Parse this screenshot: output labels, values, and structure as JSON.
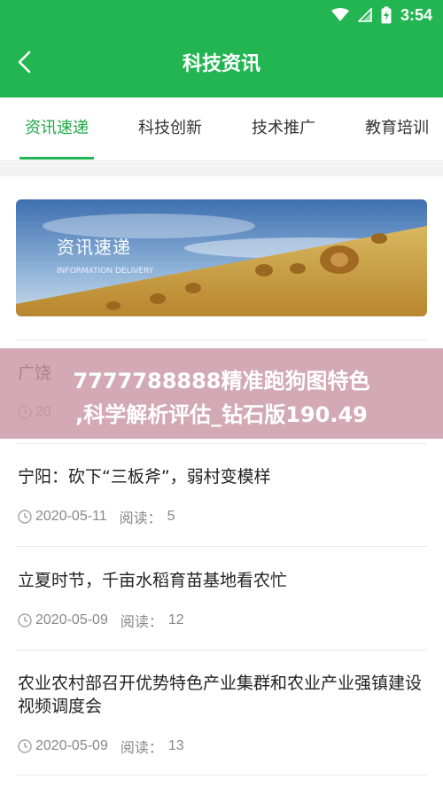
{
  "status_bar": {
    "time": "3:54",
    "icons": [
      "wifi-icon",
      "signal-icon",
      "battery-icon"
    ]
  },
  "header": {
    "title": "科技资讯",
    "back_icon": "chevron-left-icon",
    "color": "#22b551"
  },
  "tabs": [
    {
      "label": "资讯速递",
      "active": true
    },
    {
      "label": "科技创新",
      "active": false
    },
    {
      "label": "技术推广",
      "active": false
    },
    {
      "label": "教育培训",
      "active": false
    }
  ],
  "banner": {
    "title": "资讯速递",
    "subtitle": "INFORMATION DELIVERY"
  },
  "articles": [
    {
      "title": "广饶",
      "date": "20",
      "read_label": "",
      "reads": ""
    },
    {
      "title": "宁阳：砍下“三板斧”，弱村变模样",
      "date": "2020-05-11",
      "read_label": "阅读：",
      "reads": "5"
    },
    {
      "title": "立夏时节，千亩水稻育苗基地看农忙",
      "date": "2020-05-09",
      "read_label": "阅读：",
      "reads": "12"
    },
    {
      "title": "农业农村部召开优势特色产业集群和农业产业强镇建设视频调度会",
      "date": "2020-05-09",
      "read_label": "阅读：",
      "reads": "13"
    }
  ],
  "overlay": {
    "line1": "7777788888精准跑狗图特色",
    "line2": ",科学解析评估_钻石版190.49"
  },
  "colors": {
    "accent": "#22b551",
    "active_tab_text": "#22a84a",
    "overlay": "#c896a5"
  }
}
